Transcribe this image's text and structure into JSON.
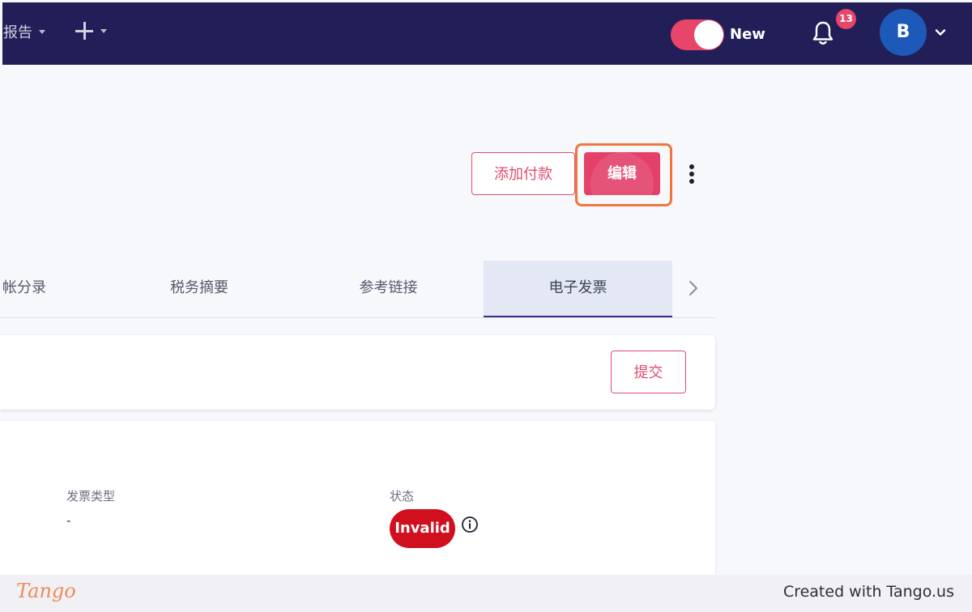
{
  "nav": {
    "reports_label": "报告",
    "toggle_label": "New",
    "notification_count": "13",
    "avatar_initial": "B"
  },
  "actions": {
    "add_payment_label": "添加付款",
    "edit_label": "编辑"
  },
  "tabs": [
    {
      "label": "帐分录"
    },
    {
      "label": "税务摘要"
    },
    {
      "label": "参考链接"
    },
    {
      "label": "电子发票",
      "active": true
    }
  ],
  "submit": {
    "label": "提交"
  },
  "details": {
    "invoice_type_label": "发票类型",
    "invoice_type_value": "-",
    "status_label": "状态",
    "status_value": "Invalid"
  },
  "footer": {
    "logo": "Tango",
    "created_with": "Created with Tango.us"
  },
  "colors": {
    "nav_bg": "#221f58",
    "accent": "#e4406a",
    "highlight": "#f0753f",
    "status_invalid": "#d0101e",
    "avatar": "#1d59b8"
  }
}
